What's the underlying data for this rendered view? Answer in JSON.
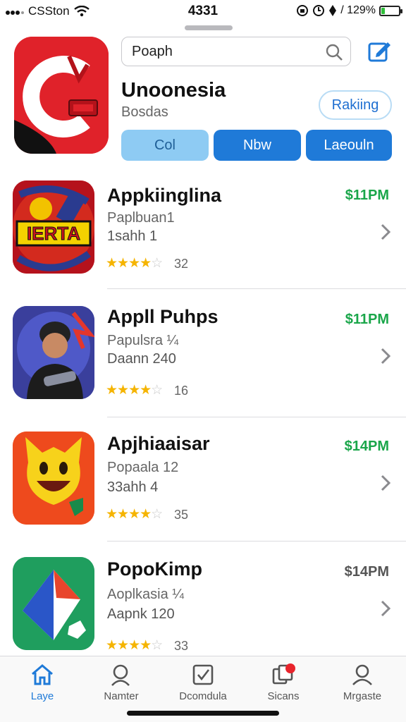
{
  "status_bar": {
    "carrier": "CSSton",
    "time": "4331",
    "battery_text": "/ 129%",
    "battery_level": 0.2
  },
  "header": {
    "search_text": "Poaph",
    "app_title": "Unoonesia",
    "app_subtitle": "Bosdas",
    "ranking_label": "Rakiing",
    "segments": [
      "Col",
      "Nbw",
      "Laeouln"
    ]
  },
  "apps": [
    {
      "name": "Appkiinglina",
      "price": "$11PM",
      "price_color": "#1aa64a",
      "line1": "Paplbuan1",
      "line2": "1sahh 1",
      "stars": 4,
      "rating_count": "32",
      "icon_text": "IERTA"
    },
    {
      "name": "Appll Puhps",
      "price": "$11PM",
      "price_color": "#1aa64a",
      "line1": "Papulsra ¼",
      "line2": "Daann 240",
      "stars": 4,
      "rating_count": "16"
    },
    {
      "name": "Apjhiaaisar",
      "price": "$14PM",
      "price_color": "#1aa64a",
      "line1": "Popaala 12",
      "line2": "33ahh 4",
      "stars": 4,
      "rating_count": "35"
    },
    {
      "name": "PopoKimp",
      "price": "$14PM",
      "price_color": "#555555",
      "line1": "Aoplkasia ¼",
      "line2": "Aapnk 120",
      "stars": 4,
      "rating_count": "33"
    }
  ],
  "tabbar": {
    "tabs": [
      {
        "label": "Laye",
        "icon": "home-icon",
        "active": true
      },
      {
        "label": "Namter",
        "icon": "person-search-icon",
        "active": false
      },
      {
        "label": "Dcomdula",
        "icon": "checkbox-icon",
        "active": false
      },
      {
        "label": "Sicans",
        "icon": "badge-stack-icon",
        "active": false
      },
      {
        "label": "Mrgaste",
        "icon": "account-icon",
        "active": false
      }
    ]
  },
  "colors": {
    "accent": "#1f7ad8",
    "price_green": "#1aa64a",
    "star": "#f5b400"
  }
}
